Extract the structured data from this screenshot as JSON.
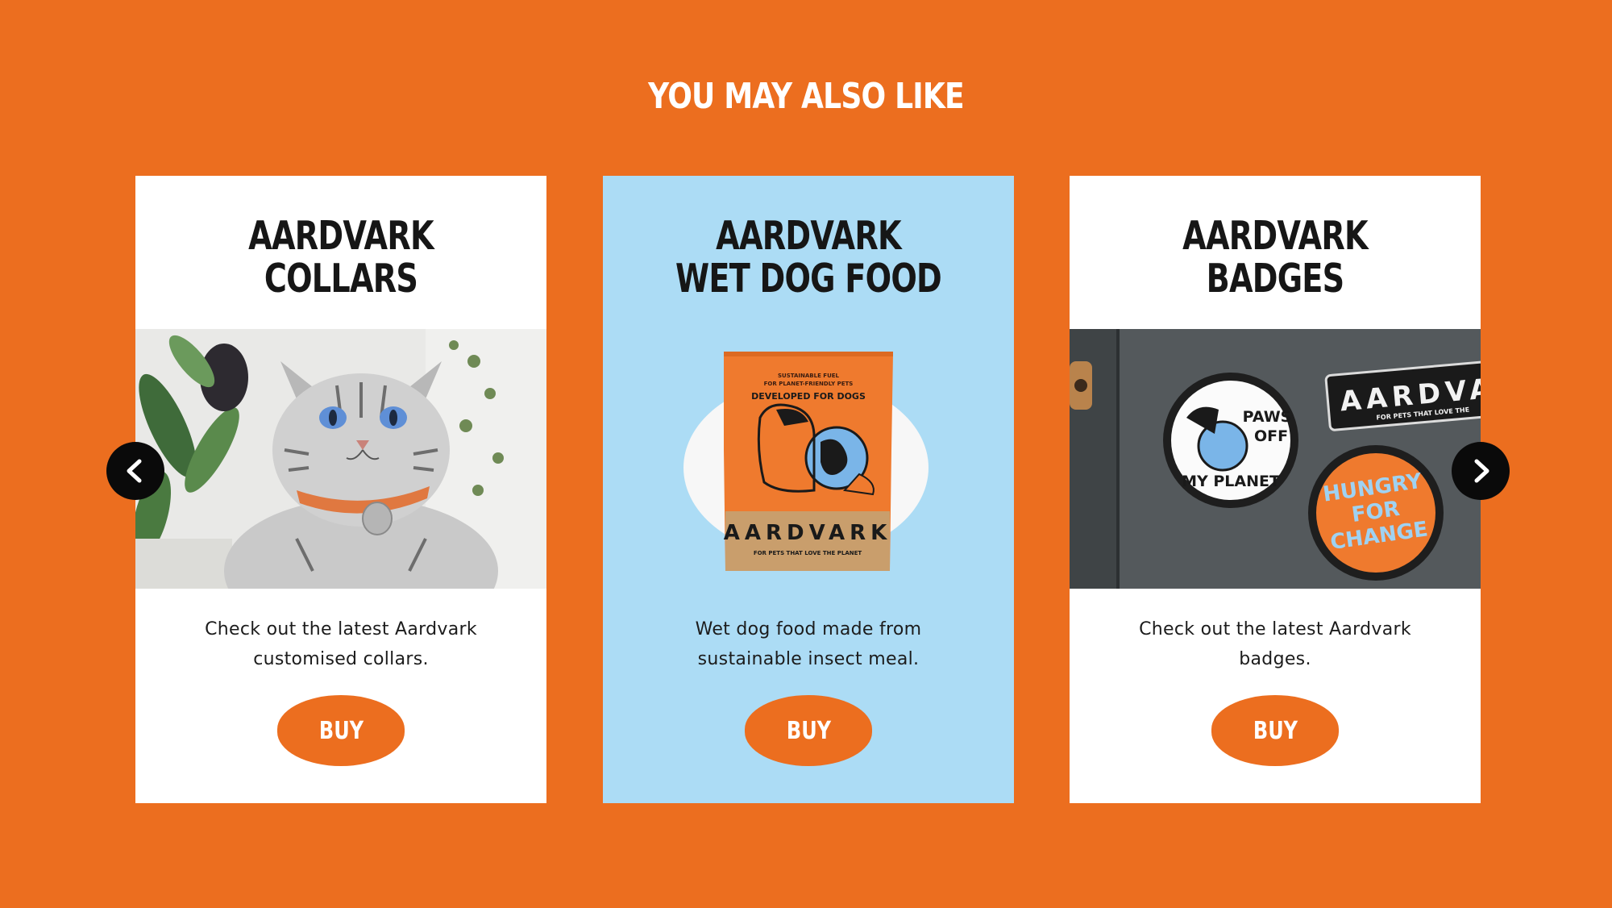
{
  "section": {
    "title": "YOU MAY ALSO LIKE"
  },
  "cards": [
    {
      "title_line1": "AARDVARK",
      "title_line2": "COLLARS",
      "desc_line1": "Check out the latest Aardvark",
      "desc_line2": "customised collars.",
      "buy_label": "BUY",
      "image": "cat-with-orange-collar"
    },
    {
      "title_line1": "AARDVARK",
      "title_line2": "WET DOG FOOD",
      "desc_line1": "Wet dog food made from",
      "desc_line2": "sustainable insect meal.",
      "buy_label": "BUY",
      "image": "dog-food-pouch",
      "pack": {
        "small_line1": "SUSTAINABLE FUEL",
        "small_line2": "FOR PLANET-FRIENDLY PETS",
        "developed": "DEVELOPED FOR DOGS",
        "brand": "AARDVARK",
        "tagline": "FOR PETS THAT LOVE THE PLANET"
      }
    },
    {
      "title_line1": "AARDVARK",
      "title_line2": "BADGES",
      "desc_line1": "Check out the latest Aardvark",
      "desc_line2": "badges.",
      "buy_label": "BUY",
      "image": "badges-on-bag",
      "badges": {
        "patch_brand": "AARDVA",
        "patch_tagline": "FOR PETS THAT LOVE THE",
        "paws1": "PAWS",
        "paws2": "OFF",
        "paws3": "MY PLANET",
        "hungry1": "HUNGRY",
        "hungry2": "FOR",
        "hungry3": "CHANGE"
      }
    }
  ],
  "nav": {
    "prev_icon": "chevron-left-icon",
    "next_icon": "chevron-right-icon"
  },
  "colors": {
    "background": "#EC6E1F",
    "card_blue": "#ACDCF5",
    "button": "#EC6E1F"
  }
}
